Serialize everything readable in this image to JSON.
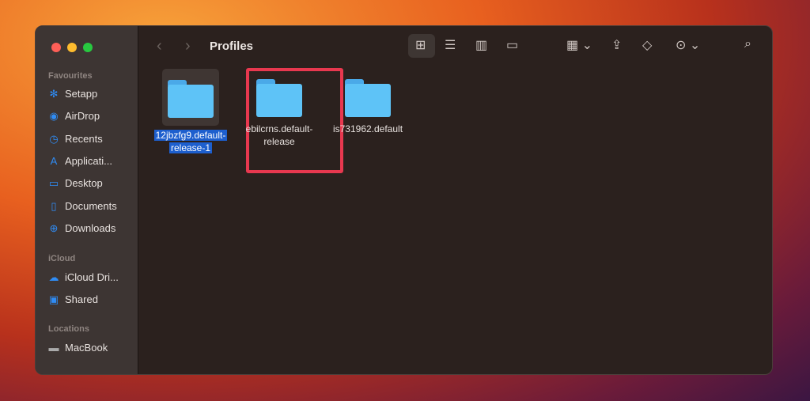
{
  "window": {
    "title": "Profiles"
  },
  "sidebar": {
    "sections": [
      {
        "label": "Favourites",
        "items": [
          {
            "label": "Setapp",
            "icon": "setapp-icon"
          },
          {
            "label": "AirDrop",
            "icon": "airdrop-icon"
          },
          {
            "label": "Recents",
            "icon": "clock-icon"
          },
          {
            "label": "Applicati...",
            "icon": "applications-icon"
          },
          {
            "label": "Desktop",
            "icon": "desktop-icon"
          },
          {
            "label": "Documents",
            "icon": "document-icon"
          },
          {
            "label": "Downloads",
            "icon": "download-icon"
          }
        ]
      },
      {
        "label": "iCloud",
        "items": [
          {
            "label": "iCloud Dri...",
            "icon": "cloud-icon"
          },
          {
            "label": "Shared",
            "icon": "shared-folder-icon"
          }
        ]
      },
      {
        "label": "Locations",
        "items": [
          {
            "label": "MacBook",
            "icon": "disk-icon"
          }
        ]
      }
    ]
  },
  "files": [
    {
      "name_line1": "12jbzfg9.default-",
      "name_line2": "release-1",
      "selected": true
    },
    {
      "name_line1": "ebilcrns.default-",
      "name_line2": "release",
      "selected": false
    },
    {
      "name_line1": "is731962.default",
      "name_line2": "",
      "selected": false
    }
  ],
  "colors": {
    "folder": "#5ec3f7",
    "selection": "#1d5fce",
    "highlight_box": "#e8384f"
  }
}
